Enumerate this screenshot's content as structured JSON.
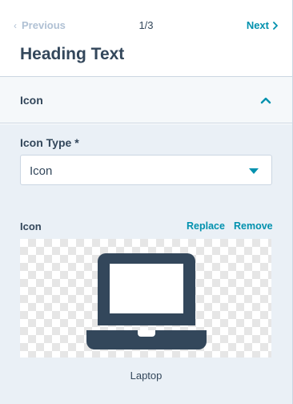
{
  "nav": {
    "previous_label": "Previous",
    "page_indicator": "1/3",
    "next_label": "Next"
  },
  "heading": "Heading Text",
  "section": {
    "title": "Icon",
    "expanded": true
  },
  "icon_type": {
    "label": "Icon Type *",
    "value": "Icon"
  },
  "icon": {
    "label": "Icon",
    "replace_label": "Replace",
    "remove_label": "Remove",
    "preview_icon": "laptop-icon",
    "name": "Laptop"
  },
  "colors": {
    "accent": "#0091ae",
    "text": "#33475b",
    "disabled": "#b0c1d4",
    "panel_bg": "#eaf0f6"
  }
}
